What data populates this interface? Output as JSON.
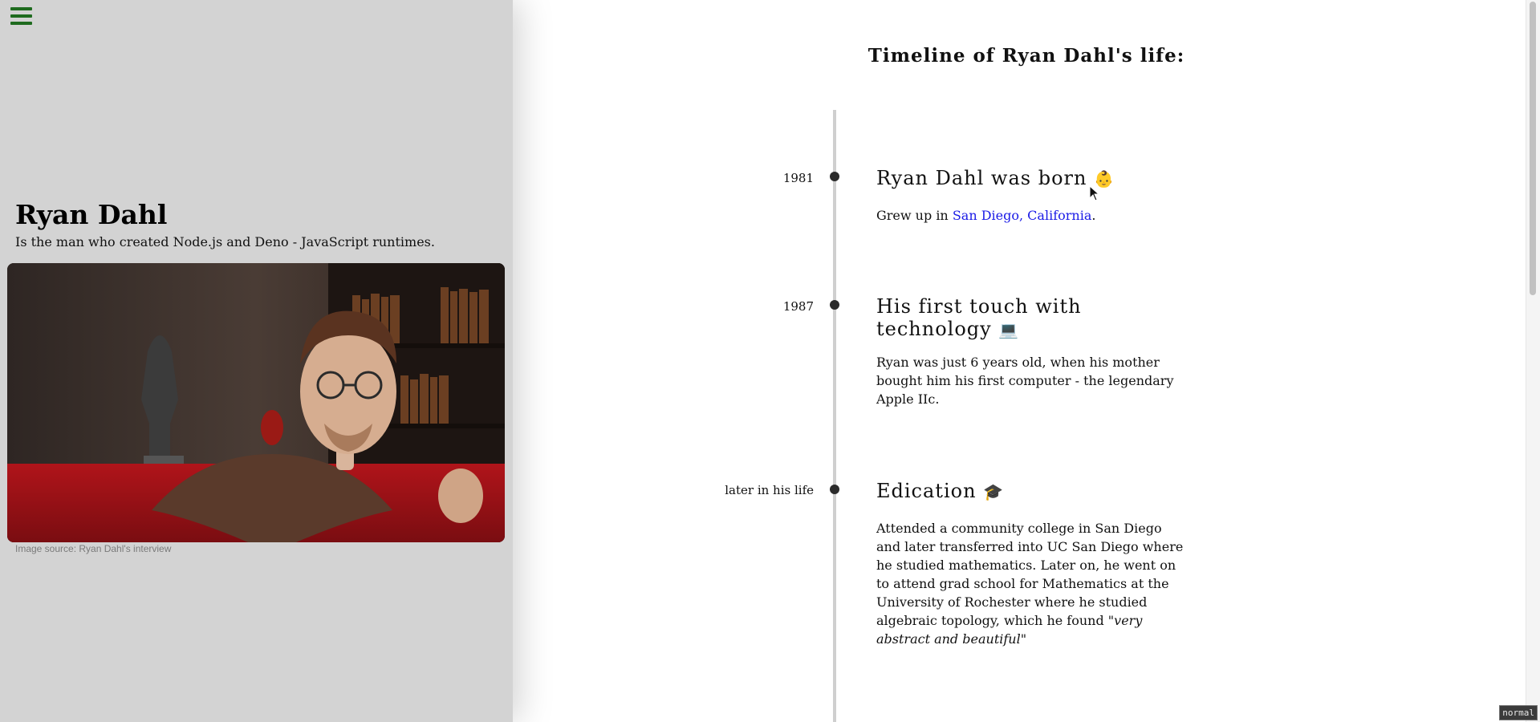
{
  "sidebar": {
    "menu_icon": "hamburger-menu-icon",
    "name": "Ryan Dahl",
    "tagline": "Is the man who created Node.js and Deno - JavaScript runtimes.",
    "image_caption": "Image source: Ryan Dahl's interview",
    "menu_color": "#1f6b1f",
    "background": "#d3d3d3"
  },
  "main": {
    "title": "Timeline of Ryan Dahl's life:",
    "entries": [
      {
        "date": "1981",
        "heading": "Ryan Dahl was born",
        "emoji": "👶",
        "body_prefix": "Grew up in ",
        "link_text": "San Diego, California",
        "body_suffix": "."
      },
      {
        "date": "1987",
        "heading": "His first touch with technology",
        "emoji": "💻",
        "body": "Ryan was just 6 years old, when his mother bought him his first computer - the legendary Apple IIc."
      },
      {
        "date": "later in his life",
        "heading": "Edication",
        "emoji": "🎓",
        "body_prefix": "Attended a community college in San Diego and later transferred into UC San Diego where he studied mathematics. Later on, he went on to attend grad school for Mathematics at the University of Rochester where he studied algebraic topology, which he found ",
        "body_italic": "\"very abstract and beautiful\""
      }
    ]
  },
  "status": {
    "mode": "normal"
  },
  "colors": {
    "link": "#1a1ae6",
    "timeline_line": "#cfcfcf",
    "timeline_dot": "#2b2b2b"
  }
}
